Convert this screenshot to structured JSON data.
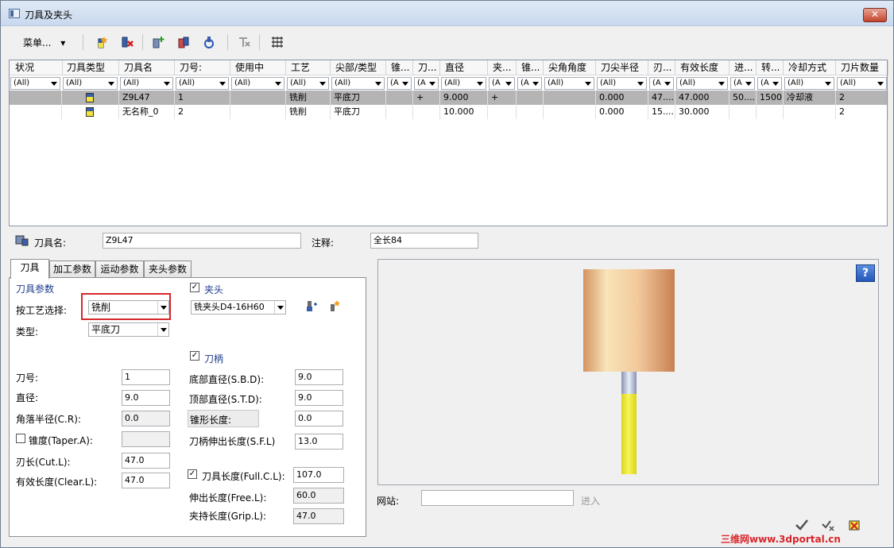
{
  "window": {
    "title": "刀具及夹头",
    "close_label": "✕"
  },
  "toolbar": {
    "menu_label": "菜单...",
    "menu_arrow": "▾"
  },
  "grid": {
    "columns": [
      "状况",
      "刀具类型",
      "刀具名",
      "刀号:",
      "使用中",
      "工艺",
      "尖部/类型",
      "锥...",
      "刀...",
      "直径",
      "夹...",
      "锥...",
      "尖角角度",
      "刀尖半径",
      "刃...",
      "有效长度",
      "进...",
      "转...",
      "冷却方式",
      "刀片数量"
    ],
    "filters": [
      "(All)",
      "(All)",
      "(All)",
      "(All)",
      "(All)",
      "(All)",
      "(All)",
      "(A",
      "(A",
      "(All)",
      "(A",
      "(A",
      "(All)",
      "(All)",
      "(A",
      "(All)",
      "(A",
      "(A",
      "(All)",
      "(All)"
    ],
    "rows": [
      [
        "",
        "",
        "Z9L47",
        "1",
        "",
        "铣削",
        "平底刀",
        "",
        "+",
        "9.000",
        "+",
        "",
        "",
        "0.000",
        "47....",
        "47.000",
        "50....",
        "1500",
        "冷却液",
        "2"
      ],
      [
        "",
        "",
        "无名称_0",
        "2",
        "",
        "铣削",
        "平底刀",
        "",
        "",
        "10.000",
        "",
        "",
        "",
        "0.000",
        "15....",
        "30.000",
        "",
        "",
        "",
        "2"
      ]
    ]
  },
  "tool_name": {
    "label": "刀具名:",
    "value": "Z9L47"
  },
  "comment": {
    "label": "注释:",
    "value": "全长84"
  },
  "tabs": [
    "刀具",
    "加工参数",
    "运动参数",
    "夹头参数"
  ],
  "tool_params": {
    "group": "刀具参数",
    "process_label": "按工艺选择:",
    "process_value": "铣削",
    "type_label": "类型:",
    "type_value": "平底刀",
    "fields": [
      {
        "label": "刀号:",
        "value": "1"
      },
      {
        "label": "直径:",
        "value": "9.0"
      },
      {
        "label": "角落半径(C.R):",
        "value": "0.0"
      },
      {
        "label": "锥度(Taper.A):",
        "value": ""
      },
      {
        "label": "刃长(Cut.L):",
        "value": "47.0"
      },
      {
        "label": "有效长度(Clear.L):",
        "value": "47.0"
      }
    ],
    "taper_checked": false
  },
  "holder": {
    "label": "夹头",
    "checked": true,
    "value": "铣夹头D4-16H60"
  },
  "shank": {
    "label": "刀柄",
    "checked": true,
    "fields": [
      {
        "label": "底部直径(S.B.D):",
        "value": "9.0"
      },
      {
        "label": "顶部直径(S.T.D):",
        "value": "9.0"
      },
      {
        "label": "锥形长度:",
        "value": "0.0"
      },
      {
        "label": "刀柄伸出长度(S.F.L)",
        "value": "13.0"
      }
    ]
  },
  "length": {
    "full_label": "刀具长度(Full.C.L):",
    "full_value": "107.0",
    "full_checked": true,
    "free_label": "伸出长度(Free.L):",
    "free_value": "60.0",
    "grip_label": "夹持长度(Grip.L):",
    "grip_value": "47.0"
  },
  "website": {
    "label": "网站:",
    "value": "",
    "go_label": "进入"
  },
  "help_label": "?",
  "watermark": "三维网www.3dportal.cn",
  "colors": {
    "highlight": "#d8252a",
    "holder_top": "#f7e4b8",
    "holder_bottom": "#d89a6c",
    "cutter": "#f4ef1c"
  }
}
